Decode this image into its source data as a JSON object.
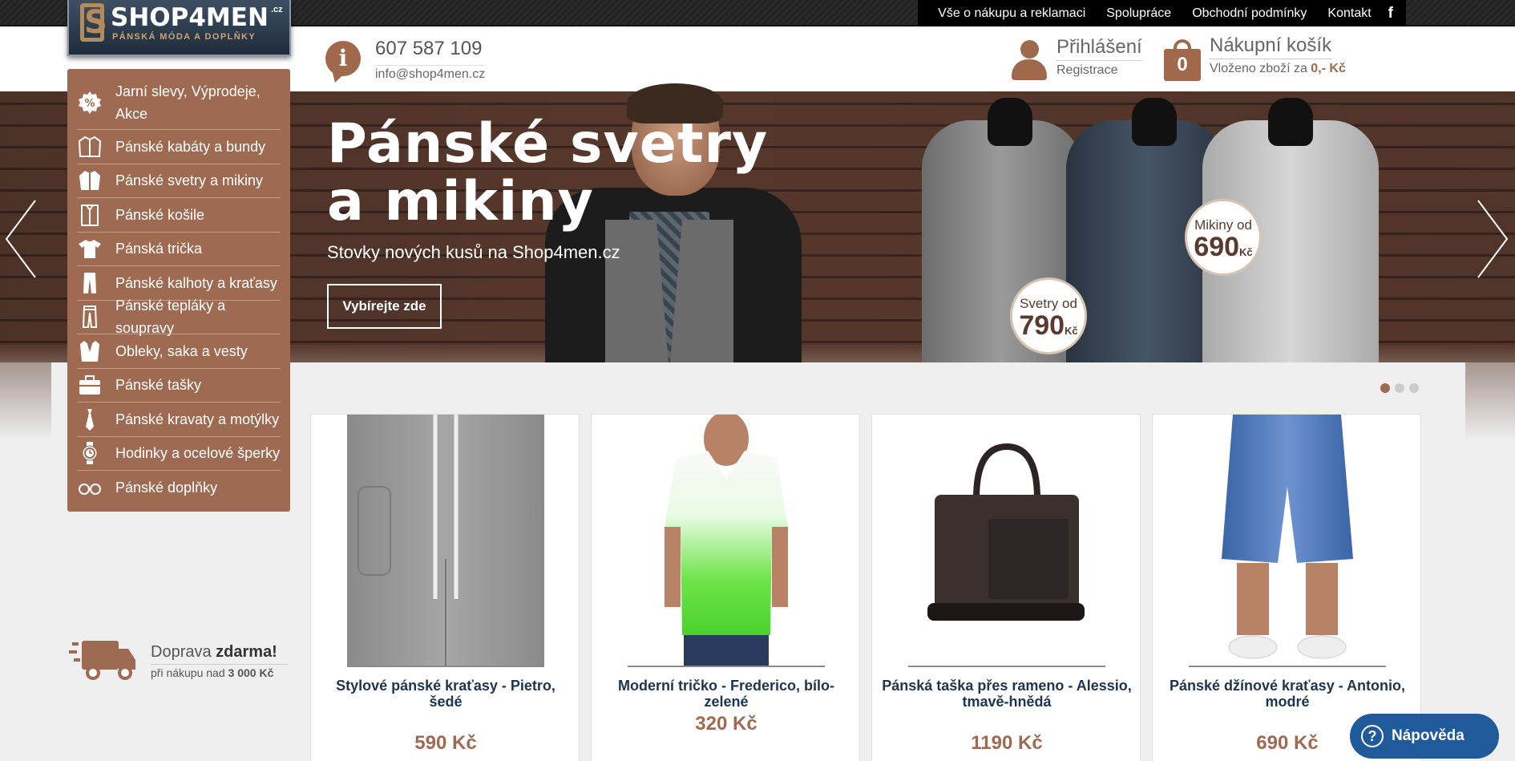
{
  "topnav": {
    "links": [
      "Vše o nákupu a reklamaci",
      "Spolupráce",
      "Obchodní podmínky",
      "Kontakt"
    ],
    "facebook": "f"
  },
  "logo": {
    "main": "SHOP4MEN",
    "tld": ".cz",
    "tagline": "PÁNSKÁ MÓDA A DOPLŇKY",
    "mark": "S"
  },
  "contact": {
    "icon": "i",
    "phone": "607 587 109",
    "email": "info@shop4men.cz"
  },
  "account": {
    "login": "Přihlášení",
    "register": "Registrace"
  },
  "cart": {
    "count": "0",
    "title": "Nákupní košík",
    "sub_prefix": "Vloženo zboží za ",
    "sub_amount": "0,- Kč"
  },
  "hero": {
    "title": "Pánské svetry a mikiny",
    "subtitle": "Stovky nových kusů na Shop4men.cz",
    "button": "Vybírejte zde",
    "badge1": {
      "text": "Svetry od",
      "price": "790",
      "currency": "Kč"
    },
    "badge2": {
      "text": "Mikiny od",
      "price": "690",
      "currency": "Kč"
    },
    "slide_count": 3,
    "active_slide": 1
  },
  "menu": [
    {
      "label": "Jarní slevy, Výprodeje, Akce",
      "icon": "percent-icon"
    },
    {
      "label": "Pánské kabáty a bundy",
      "icon": "jacket-icon"
    },
    {
      "label": "Pánské svetry a mikiny",
      "icon": "sweater-icon"
    },
    {
      "label": "Pánské košile",
      "icon": "shirt-icon"
    },
    {
      "label": "Pánská trička",
      "icon": "tshirt-icon"
    },
    {
      "label": "Pánské kalhoty a kraťasy",
      "icon": "trousers-icon"
    },
    {
      "label": "Pánské tepláky a soupravy",
      "icon": "tracksuit-icon"
    },
    {
      "label": "Obleky, saka a vesty",
      "icon": "suit-icon"
    },
    {
      "label": "Pánské tašky",
      "icon": "briefcase-icon"
    },
    {
      "label": "Pánské kravaty a motýlky",
      "icon": "tie-icon"
    },
    {
      "label": "Hodinky a ocelové šperky",
      "icon": "watch-icon"
    },
    {
      "label": "Pánské doplňky",
      "icon": "glasses-icon"
    }
  ],
  "products": [
    {
      "name": "Stylové pánské kraťasy - Pietro, šedé",
      "price": "590 Kč"
    },
    {
      "name": "Moderní tričko - Frederico, bílo-zelené",
      "price": "320 Kč"
    },
    {
      "name": "Pánská taška přes rameno - Alessio, tmavě-hnědá",
      "price": "1190 Kč"
    },
    {
      "name": "Pánské džínové kraťasy - Antonio, modré",
      "price": "690 Kč"
    }
  ],
  "shipping": {
    "line1_prefix": "Doprava ",
    "line1_bold": "zdarma!",
    "line2_prefix": "při nákupu nad ",
    "line2_bold": "3 000 Kč"
  },
  "help": {
    "label": "Nápověda",
    "icon": "?"
  },
  "colors": {
    "accent": "#9e6a51",
    "navy": "#1f3450",
    "help": "#1f5a9a"
  }
}
